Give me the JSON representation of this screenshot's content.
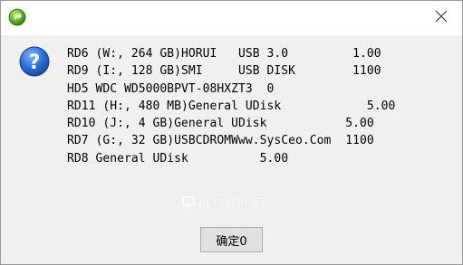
{
  "dialog": {
    "message_lines": [
      "RD6 (W:, 264 GB)HORUI   USB 3.0         1.00",
      "RD9 (I:, 128 GB)SMI     USB DISK        1100",
      "HD5 WDC WD5000BPVT-08HXZT3  0",
      "RD11 (H:, 480 MB)General UDisk            5.00",
      "RD10 (J:, 4 GB)General UDisk           5.00",
      "RD7 (G:, 32 GB)USBCDROMWww.SysCeo.Com  1100",
      "RD8 General UDisk          5.00"
    ],
    "watermark_text": "PECMD.NET",
    "ok_label": "确定0"
  },
  "colors": {
    "titlebar_bg": "#ffffff",
    "body_bg": "#f0f0f0",
    "question_icon": "#1f5fc8",
    "app_icon": "#4caf2a"
  },
  "icons": {
    "app": "green-circle-arrow-icon",
    "close": "close-icon",
    "message": "question-icon"
  }
}
